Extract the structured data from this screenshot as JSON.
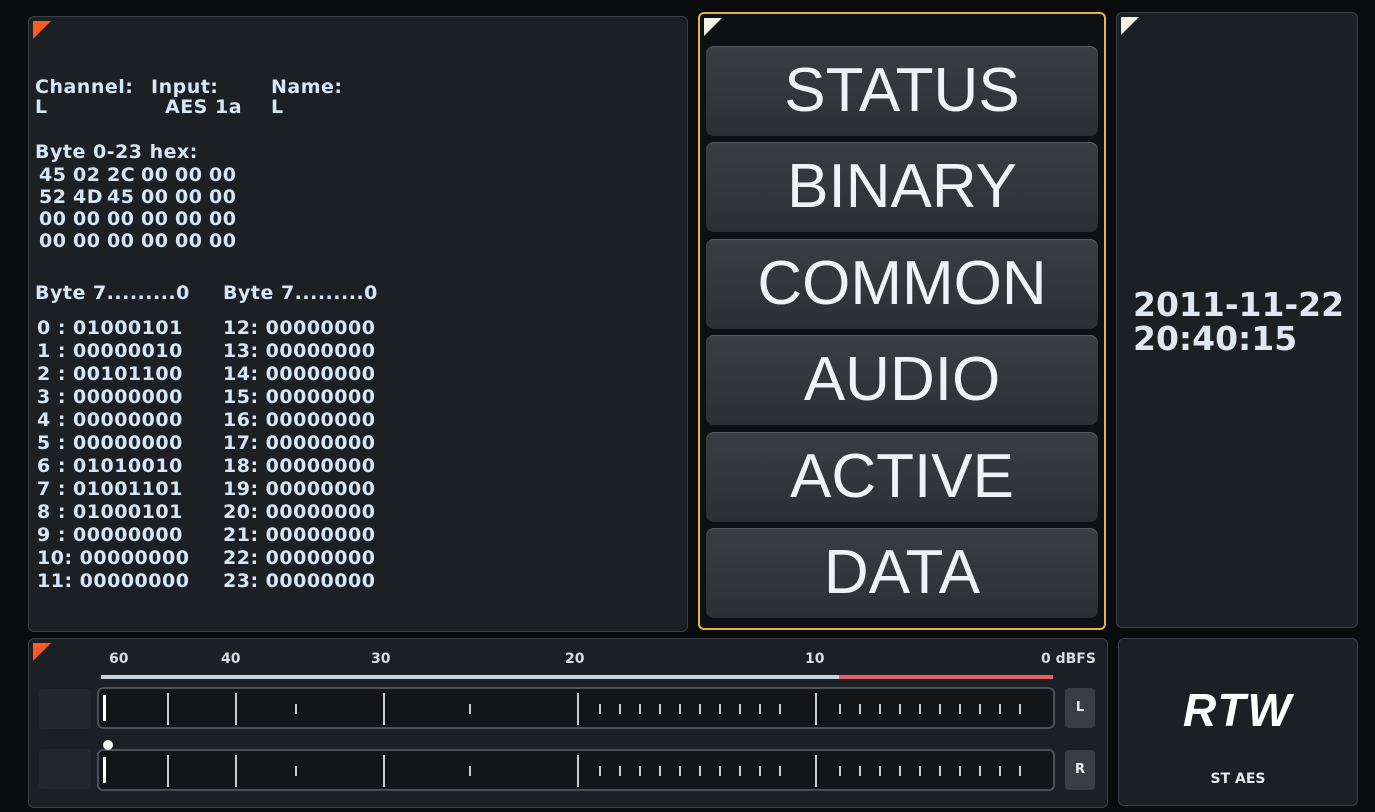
{
  "status": {
    "headers": [
      {
        "label": "Channel:",
        "value": "L"
      },
      {
        "label": "Input:",
        "value": "AES 1a"
      },
      {
        "label": "Name:",
        "value": "L"
      }
    ],
    "hex_title": "Byte 0-23 hex:",
    "hex_rows": [
      [
        "45",
        "02",
        "2C",
        "00",
        "00",
        "00"
      ],
      [
        "52",
        "4D",
        "45",
        "00",
        "00",
        "00"
      ],
      [
        "00",
        "00",
        "00",
        "00",
        "00",
        "00"
      ],
      [
        "00",
        "00",
        "00",
        "00",
        "00",
        "00"
      ]
    ],
    "binary_title": "Byte 7.........0",
    "binary_left": [
      " 0 : 01000101",
      " 1 : 00000010",
      " 2 : 00101100",
      " 3 : 00000000",
      " 4 : 00000000",
      " 5 : 00000000",
      " 6 : 01010010",
      " 7 : 01001101",
      " 8 : 01000101",
      " 9 : 00000000",
      "10: 00000000",
      "11: 00000000"
    ],
    "binary_right": [
      "12: 00000000",
      "13: 00000000",
      "14: 00000000",
      "15: 00000000",
      "16: 00000000",
      "17: 00000000",
      "18: 00000000",
      "19: 00000000",
      "20: 00000000",
      "21: 00000000",
      "22: 00000000",
      "23: 00000000"
    ]
  },
  "menu": {
    "items": [
      "STATUS",
      "BINARY",
      "COMMON",
      "AUDIO",
      "ACTIVE",
      "DATA"
    ],
    "border_color": "#e2b540"
  },
  "datetime": {
    "date": "2011-11-22",
    "time": "20:40:15"
  },
  "meter": {
    "scale_labels": [
      "60",
      "40",
      "30",
      "20",
      "10",
      "0 dBFS"
    ],
    "channels": [
      "L",
      "R"
    ],
    "over_color": "#e0606a",
    "normal_color": "#c9d3de"
  },
  "logo": {
    "brand": "RTW",
    "subtitle": "ST AES"
  }
}
